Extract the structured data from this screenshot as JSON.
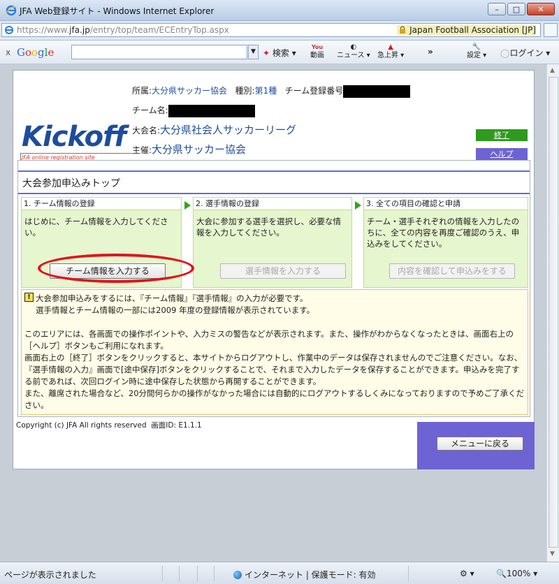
{
  "window": {
    "title": "JFA Web登録サイト - Windows Internet Explorer",
    "controls": {
      "minimize": "–",
      "maximize": "□",
      "close": "✕"
    }
  },
  "address": {
    "url_prefix": "https://www.",
    "url_host": "jfa.jp",
    "url_path": "/entry/top/team/ECEntryTop.aspx",
    "cert": "Japan Football Association [JP]"
  },
  "google_toolbar": {
    "close": "x",
    "logo": "Google",
    "search_value": "",
    "search_label": "検索",
    "video_label": "動画",
    "news_label": "ニュース",
    "rising_label": "急上昇",
    "more_label": "»",
    "settings_label": "設定",
    "login_label": "ログイン"
  },
  "header": {
    "affiliation_label": "所属:",
    "affiliation_value": "大分県サッカー協会",
    "category_label": "種別:",
    "category_value": "第1種",
    "team_reg_label": "チーム登録番号",
    "team_name_label": "チーム名:",
    "team_name_prefix": "",
    "tournament_label": "大会名:",
    "tournament_value": "大分県社会人サッカーリーグ",
    "organizer_label": "主催:",
    "organizer_value": "大分県サッカー協会",
    "end_button": "終了",
    "help_button": "ヘルプ"
  },
  "logo": {
    "text": "Kickoff",
    "subtitle": "JFA online registration site"
  },
  "main": {
    "title": "大会参加申込みトップ",
    "steps": [
      {
        "heading": "1. チーム情報の登録",
        "text": "はじめに、チーム情報を入力してください。",
        "button": "チーム情報を入力する",
        "enabled": true
      },
      {
        "heading": "2. 選手情報の登録",
        "text": "大会に参加する選手を選択し、必要な情報を入力してください。",
        "button": "選手情報を入力する",
        "enabled": false
      },
      {
        "heading": "3. 全ての項目の確認と申請",
        "text": "チーム・選手それぞれの情報を入力したのちに、全ての内容を再度ご確認のうえ、申込みをしてください。",
        "button": "内容を確認して申込みをする",
        "enabled": false
      }
    ],
    "notice": {
      "line1": "大会参加申込みをするには、『チーム情報』『選手情報』の入力が必要です。",
      "line2": "選手情報とチーム情報の一部には2009 年度の登録情報が表示されています。",
      "para2": "このエリアには、各画面での操作ポイントや、入力ミスの警告などが表示されます。また、操作がわからなくなったときは、画面右上の［ヘルプ］ボタンもご利用になれます。",
      "para3": "画面右上の［終了］ボタンをクリックすると、本サイトからログアウトし、作業中のデータは保存されませんのでご注意ください。なお、『選手情報の入力』画面で[途中保存]ボタンをクリックすることで、それまで入力したデータを保存することができます。申込みを完了する前であれば、次回ログイン時に途中保存した状態から再開することができます。",
      "para4": "また、離席された場合など、20分間何らかの操作がなかった場合には自動的にログアウトするしくみになっておりますので予めご了承ください。"
    }
  },
  "footer": {
    "copyright": "Copyright (c) JFA All rights reserved",
    "screen_id": "画面ID: E1.1.1",
    "menu_button": "メニューに戻る"
  },
  "statusbar": {
    "status": "ページが表示されました",
    "zone": "インターネット | 保護モード: 有効",
    "zoom": "100%"
  },
  "colors": {
    "brand_blue": "#1d4d9c",
    "step_green": "#e6f6cf",
    "end_green": "#2f9a1e",
    "help_purple": "#6e63d2",
    "highlight_red": "#e0141d"
  }
}
